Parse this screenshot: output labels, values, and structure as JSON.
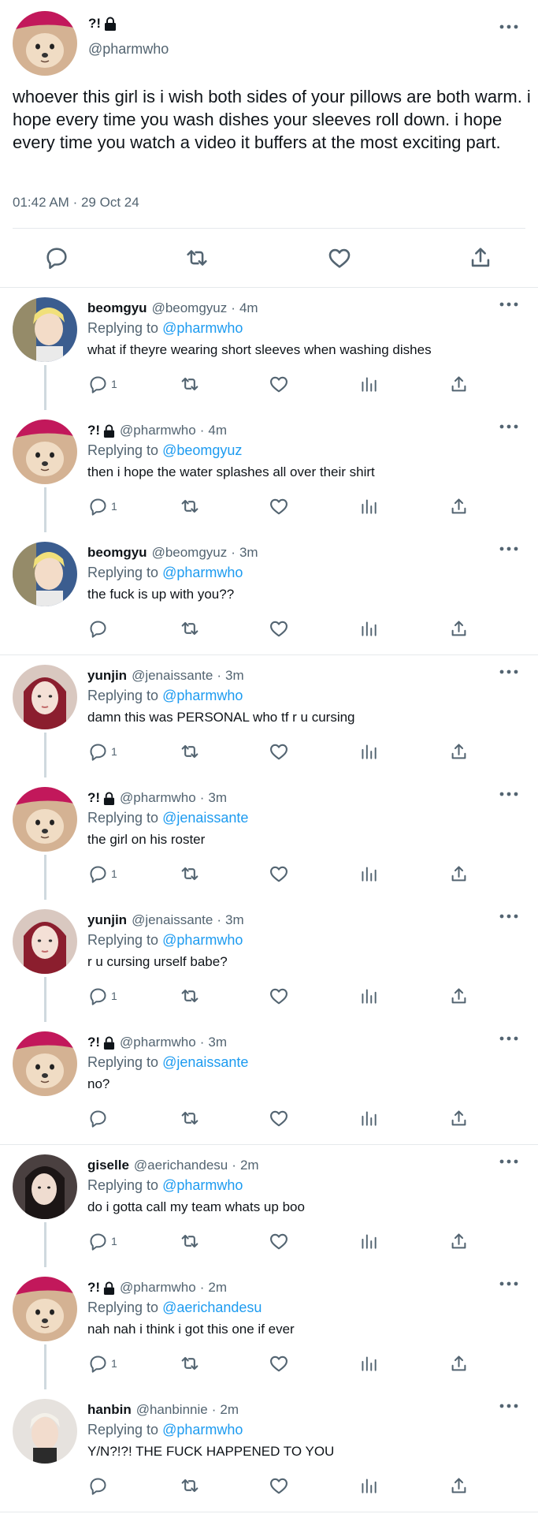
{
  "main_tweet": {
    "name": "?!",
    "handle": "@pharmwho",
    "text": "whoever this girl is i wish both sides of your pillows are both warm. i hope every time you wash dishes your sleeves roll down. i hope every time you watch a video it buffers at the most exciting part.",
    "time": "01:42 AM",
    "date": "29 Oct 24",
    "meta_sep": "·",
    "actions": [
      "reply-icon",
      "retweet-icon",
      "like-icon",
      "share-icon"
    ]
  },
  "replying_label": "Replying to ",
  "colors": {
    "link": "#1d9bf0",
    "muted": "#536471",
    "thread": "#cfd9de",
    "text": "#0f1419"
  },
  "replies": [
    {
      "name": "beomgyu",
      "locked": false,
      "handle": "@beomgyuz",
      "time": "4m",
      "reply_to": "@pharmwho",
      "text": "what if theyre wearing short sleeves when washing dishes",
      "reply_count": "1",
      "avatar": "beomgyu"
    },
    {
      "name": "?!",
      "locked": true,
      "handle": "@pharmwho",
      "time": "4m",
      "reply_to": "@beomgyuz",
      "text": "then i hope the water splashes all over their shirt",
      "reply_count": "1",
      "avatar": "dog"
    },
    {
      "name": "beomgyu",
      "locked": false,
      "handle": "@beomgyuz",
      "time": "3m",
      "reply_to": "@pharmwho",
      "text": "the fuck is up with you??",
      "reply_count": "",
      "avatar": "beomgyu"
    },
    {
      "name": "yunjin",
      "locked": false,
      "handle": "@jenaissante",
      "time": "3m",
      "reply_to": "@pharmwho",
      "text": "damn this was PERSONAL who tf r u cursing",
      "reply_count": "1",
      "avatar": "yunjin"
    },
    {
      "name": "?!",
      "locked": true,
      "handle": "@pharmwho",
      "time": "3m",
      "reply_to": "@jenaissante",
      "text": "the girl on his roster",
      "reply_count": "1",
      "avatar": "dog"
    },
    {
      "name": "yunjin",
      "locked": false,
      "handle": "@jenaissante",
      "time": "3m",
      "reply_to": "@pharmwho",
      "text": "r u cursing urself babe?",
      "reply_count": "1",
      "avatar": "yunjin"
    },
    {
      "name": "?!",
      "locked": true,
      "handle": "@pharmwho",
      "time": "3m",
      "reply_to": "@jenaissante",
      "text": "no?",
      "reply_count": "",
      "avatar": "dog"
    },
    {
      "name": "giselle",
      "locked": false,
      "handle": "@aerichandesu",
      "time": "2m",
      "reply_to": "@pharmwho",
      "text": "do i gotta call my team whats up boo",
      "reply_count": "1",
      "avatar": "giselle"
    },
    {
      "name": "?!",
      "locked": true,
      "handle": "@pharmwho",
      "time": "2m",
      "reply_to": "@aerichandesu",
      "text": "nah nah i think i got this one if ever",
      "reply_count": "1",
      "avatar": "dog"
    },
    {
      "name": "hanbin",
      "locked": false,
      "handle": "@hanbinnie",
      "time": "2m",
      "reply_to": "@pharmwho",
      "text": "Y/N?!?! THE FUCK HAPPENED TO YOU",
      "reply_count": "",
      "avatar": "hanbin"
    }
  ],
  "reply_actions": [
    "reply-icon",
    "retweet-icon",
    "like-icon",
    "views-icon",
    "share-icon"
  ]
}
